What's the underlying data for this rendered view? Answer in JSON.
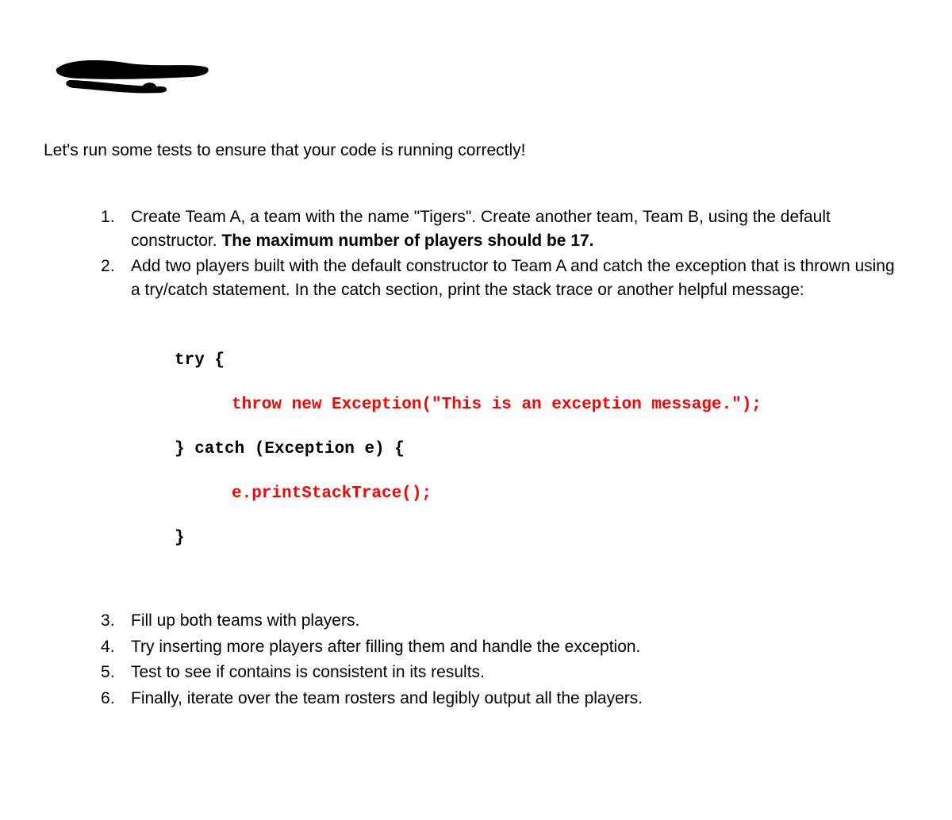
{
  "intro": "Let's run some tests to ensure that your code is running correctly!",
  "items": {
    "item1_part1": "Create Team A, a team with the name \"Tigers\". Create another team, Team B, using the default constructor. ",
    "item1_bold": "The maximum number of players should be 17.",
    "item2": "Add two players built with the default constructor to Team A and catch the exception that is thrown using a try/catch statement. In the catch section, print the stack trace or another helpful message:",
    "item3": "Fill up both teams with players.",
    "item4": "Try inserting more players after filling them and handle the exception.",
    "item5": "Test to see if contains is consistent in its results.",
    "item6": "Finally, iterate over the team rosters and legibly output all the players."
  },
  "code": {
    "l1": "try {",
    "l2": "throw new Exception(\"This is an exception message.\");",
    "l3": "} catch (Exception e) {",
    "l4": "e.printStackTrace();",
    "l5": "}"
  }
}
